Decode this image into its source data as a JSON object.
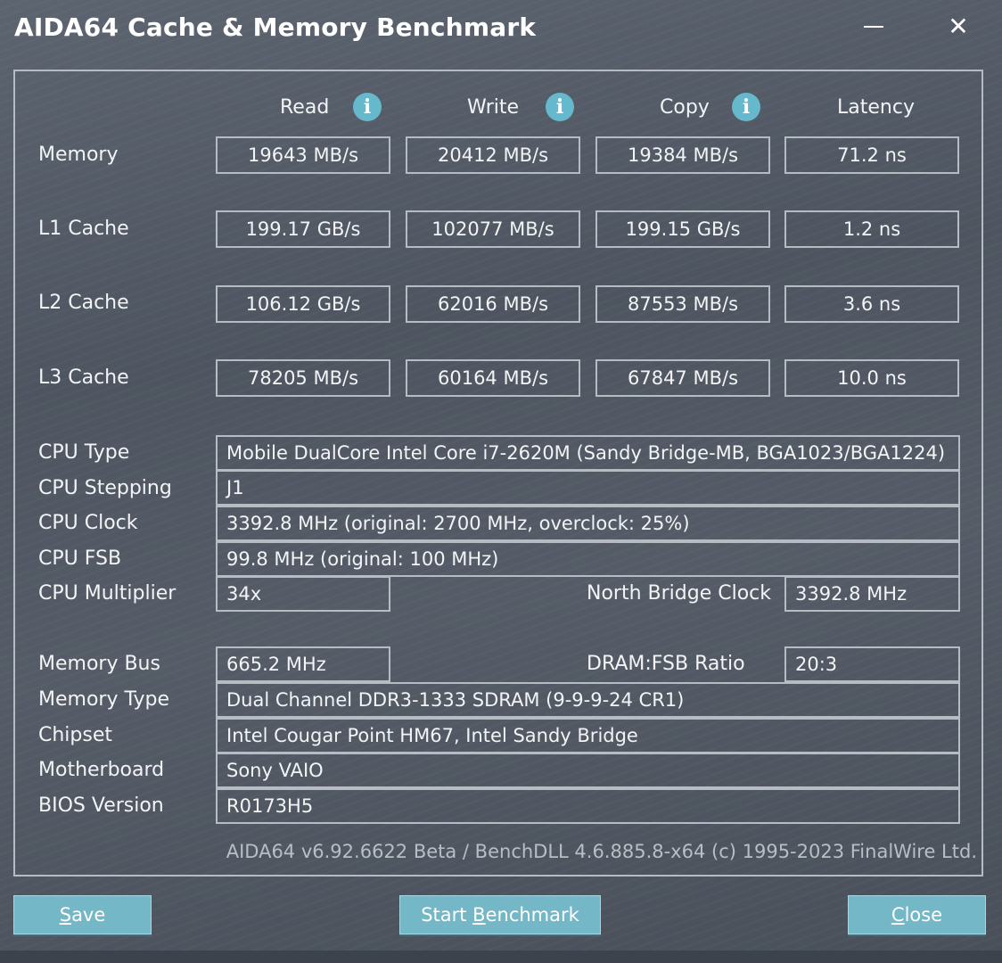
{
  "window": {
    "title": "AIDA64 Cache & Memory Benchmark"
  },
  "columns": {
    "read": "Read",
    "write": "Write",
    "copy": "Copy",
    "latency": "Latency"
  },
  "benchmarks": [
    {
      "label": "Memory",
      "read": "19643 MB/s",
      "write": "20412 MB/s",
      "copy": "19384 MB/s",
      "latency": "71.2 ns"
    },
    {
      "label": "L1 Cache",
      "read": "199.17 GB/s",
      "write": "102077 MB/s",
      "copy": "199.15 GB/s",
      "latency": "1.2 ns"
    },
    {
      "label": "L2 Cache",
      "read": "106.12 GB/s",
      "write": "62016 MB/s",
      "copy": "87553 MB/s",
      "latency": "3.6 ns"
    },
    {
      "label": "L3 Cache",
      "read": "78205 MB/s",
      "write": "60164 MB/s",
      "copy": "67847 MB/s",
      "latency": "10.0 ns"
    }
  ],
  "cpu": {
    "type_label": "CPU Type",
    "type_value": "Mobile DualCore Intel Core i7-2620M  (Sandy Bridge-MB, BGA1023/BGA1224)",
    "stepping_label": "CPU Stepping",
    "stepping_value": "J1",
    "clock_label": "CPU Clock",
    "clock_value": "3392.8 MHz  (original: 2700 MHz, overclock: 25%)",
    "fsb_label": "CPU FSB",
    "fsb_value": "99.8 MHz  (original: 100 MHz)",
    "multiplier_label": "CPU Multiplier",
    "multiplier_value": "34x",
    "nb_clock_label": "North Bridge Clock",
    "nb_clock_value": "3392.8 MHz"
  },
  "memory": {
    "bus_label": "Memory Bus",
    "bus_value": "665.2 MHz",
    "ratio_label": "DRAM:FSB Ratio",
    "ratio_value": "20:3",
    "type_label": "Memory Type",
    "type_value": "Dual Channel DDR3-1333 SDRAM  (9-9-9-24 CR1)",
    "chipset_label": "Chipset",
    "chipset_value": "Intel Cougar Point HM67, Intel Sandy Bridge",
    "motherboard_label": "Motherboard",
    "motherboard_value": "Sony VAIO",
    "bios_label": "BIOS Version",
    "bios_value": "R0173H5"
  },
  "footer": "AIDA64 v6.92.6622 Beta / BenchDLL 4.6.885.8-x64  (c) 1995-2023 FinalWire Ltd.",
  "buttons": {
    "save_first": "S",
    "save_rest": "ave",
    "start_pre": "Start ",
    "start_u": "B",
    "start_rest": "enchmark",
    "close_first": "C",
    "close_rest": "lose"
  },
  "icons": {
    "info": "i",
    "close": "✕"
  },
  "colors": {
    "accent_button": "#74b7c7",
    "info_icon": "#66b8cc",
    "border": "#b7bcc2"
  }
}
